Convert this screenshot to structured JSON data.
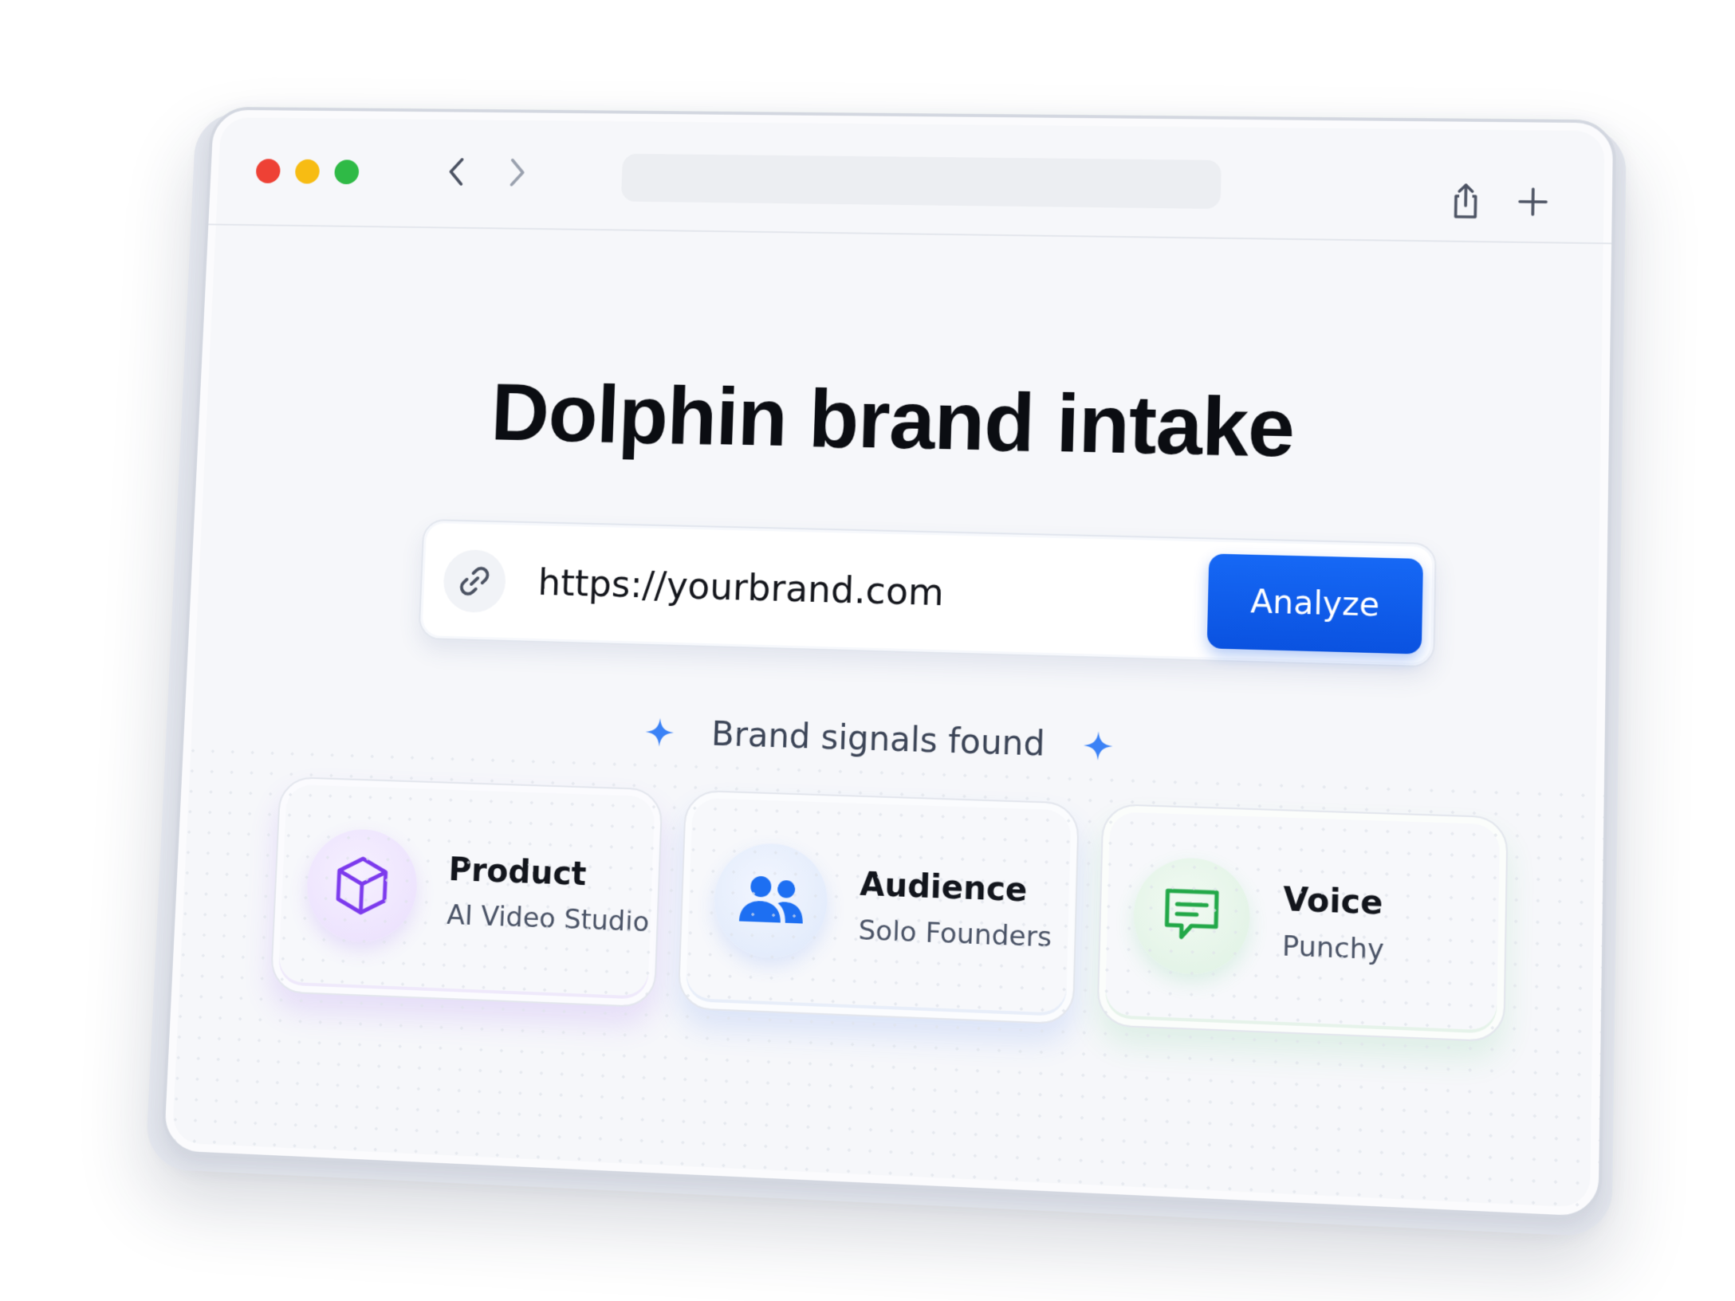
{
  "window": {
    "controls": [
      "close",
      "minimize",
      "maximize"
    ],
    "icons": {
      "back": "chevron-left-icon",
      "forward": "chevron-right-icon",
      "share": "share-icon",
      "new_tab": "plus-icon"
    }
  },
  "page": {
    "title": "Dolphin brand intake"
  },
  "url_input": {
    "icon": "link-icon",
    "value": "https://yourbrand.com"
  },
  "analyze_button": {
    "label": "Analyze",
    "color": "#0A5BEA"
  },
  "signals": {
    "heading": "Brand signals found",
    "sparkle_color": "#3B82F6",
    "cards": [
      {
        "label": "Product",
        "value": "AI Video Studio",
        "icon": "cube-icon",
        "accent": "#7C3AED"
      },
      {
        "label": "Audience",
        "value": "Solo Founders",
        "icon": "users-icon",
        "accent": "#1D6FF2"
      },
      {
        "label": "Voice",
        "value": "Punchy",
        "icon": "chat-bubble-icon",
        "accent": "#22A848"
      }
    ]
  }
}
